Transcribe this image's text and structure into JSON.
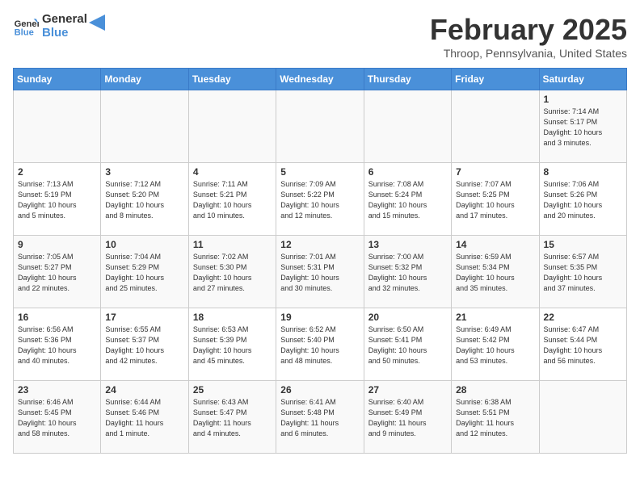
{
  "header": {
    "logo_line1": "General",
    "logo_line2": "Blue",
    "month_title": "February 2025",
    "location": "Throop, Pennsylvania, United States"
  },
  "weekdays": [
    "Sunday",
    "Monday",
    "Tuesday",
    "Wednesday",
    "Thursday",
    "Friday",
    "Saturday"
  ],
  "weeks": [
    [
      {
        "day": "",
        "info": ""
      },
      {
        "day": "",
        "info": ""
      },
      {
        "day": "",
        "info": ""
      },
      {
        "day": "",
        "info": ""
      },
      {
        "day": "",
        "info": ""
      },
      {
        "day": "",
        "info": ""
      },
      {
        "day": "1",
        "info": "Sunrise: 7:14 AM\nSunset: 5:17 PM\nDaylight: 10 hours\nand 3 minutes."
      }
    ],
    [
      {
        "day": "2",
        "info": "Sunrise: 7:13 AM\nSunset: 5:19 PM\nDaylight: 10 hours\nand 5 minutes."
      },
      {
        "day": "3",
        "info": "Sunrise: 7:12 AM\nSunset: 5:20 PM\nDaylight: 10 hours\nand 8 minutes."
      },
      {
        "day": "4",
        "info": "Sunrise: 7:11 AM\nSunset: 5:21 PM\nDaylight: 10 hours\nand 10 minutes."
      },
      {
        "day": "5",
        "info": "Sunrise: 7:09 AM\nSunset: 5:22 PM\nDaylight: 10 hours\nand 12 minutes."
      },
      {
        "day": "6",
        "info": "Sunrise: 7:08 AM\nSunset: 5:24 PM\nDaylight: 10 hours\nand 15 minutes."
      },
      {
        "day": "7",
        "info": "Sunrise: 7:07 AM\nSunset: 5:25 PM\nDaylight: 10 hours\nand 17 minutes."
      },
      {
        "day": "8",
        "info": "Sunrise: 7:06 AM\nSunset: 5:26 PM\nDaylight: 10 hours\nand 20 minutes."
      }
    ],
    [
      {
        "day": "9",
        "info": "Sunrise: 7:05 AM\nSunset: 5:27 PM\nDaylight: 10 hours\nand 22 minutes."
      },
      {
        "day": "10",
        "info": "Sunrise: 7:04 AM\nSunset: 5:29 PM\nDaylight: 10 hours\nand 25 minutes."
      },
      {
        "day": "11",
        "info": "Sunrise: 7:02 AM\nSunset: 5:30 PM\nDaylight: 10 hours\nand 27 minutes."
      },
      {
        "day": "12",
        "info": "Sunrise: 7:01 AM\nSunset: 5:31 PM\nDaylight: 10 hours\nand 30 minutes."
      },
      {
        "day": "13",
        "info": "Sunrise: 7:00 AM\nSunset: 5:32 PM\nDaylight: 10 hours\nand 32 minutes."
      },
      {
        "day": "14",
        "info": "Sunrise: 6:59 AM\nSunset: 5:34 PM\nDaylight: 10 hours\nand 35 minutes."
      },
      {
        "day": "15",
        "info": "Sunrise: 6:57 AM\nSunset: 5:35 PM\nDaylight: 10 hours\nand 37 minutes."
      }
    ],
    [
      {
        "day": "16",
        "info": "Sunrise: 6:56 AM\nSunset: 5:36 PM\nDaylight: 10 hours\nand 40 minutes."
      },
      {
        "day": "17",
        "info": "Sunrise: 6:55 AM\nSunset: 5:37 PM\nDaylight: 10 hours\nand 42 minutes."
      },
      {
        "day": "18",
        "info": "Sunrise: 6:53 AM\nSunset: 5:39 PM\nDaylight: 10 hours\nand 45 minutes."
      },
      {
        "day": "19",
        "info": "Sunrise: 6:52 AM\nSunset: 5:40 PM\nDaylight: 10 hours\nand 48 minutes."
      },
      {
        "day": "20",
        "info": "Sunrise: 6:50 AM\nSunset: 5:41 PM\nDaylight: 10 hours\nand 50 minutes."
      },
      {
        "day": "21",
        "info": "Sunrise: 6:49 AM\nSunset: 5:42 PM\nDaylight: 10 hours\nand 53 minutes."
      },
      {
        "day": "22",
        "info": "Sunrise: 6:47 AM\nSunset: 5:44 PM\nDaylight: 10 hours\nand 56 minutes."
      }
    ],
    [
      {
        "day": "23",
        "info": "Sunrise: 6:46 AM\nSunset: 5:45 PM\nDaylight: 10 hours\nand 58 minutes."
      },
      {
        "day": "24",
        "info": "Sunrise: 6:44 AM\nSunset: 5:46 PM\nDaylight: 11 hours\nand 1 minute."
      },
      {
        "day": "25",
        "info": "Sunrise: 6:43 AM\nSunset: 5:47 PM\nDaylight: 11 hours\nand 4 minutes."
      },
      {
        "day": "26",
        "info": "Sunrise: 6:41 AM\nSunset: 5:48 PM\nDaylight: 11 hours\nand 6 minutes."
      },
      {
        "day": "27",
        "info": "Sunrise: 6:40 AM\nSunset: 5:49 PM\nDaylight: 11 hours\nand 9 minutes."
      },
      {
        "day": "28",
        "info": "Sunrise: 6:38 AM\nSunset: 5:51 PM\nDaylight: 11 hours\nand 12 minutes."
      },
      {
        "day": "",
        "info": ""
      }
    ]
  ]
}
